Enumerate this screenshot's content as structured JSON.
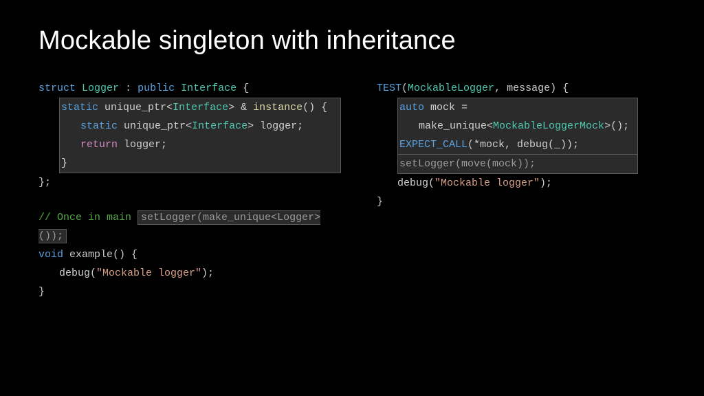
{
  "title": "Mockable singleton with inheritance",
  "left": {
    "l1_struct": "struct",
    "l1_logger": "Logger",
    "l1_colon": " : ",
    "l1_public": "public",
    "l1_interface": "Interface",
    "l1_brace": " {",
    "l2_static": "static",
    "l2_uptr": " unique_ptr<",
    "l2_iface": "Interface",
    "l2_ref": "> & ",
    "l2_inst": "instance",
    "l2_tail": "() {",
    "l3_static": "static",
    "l3_uptr": " unique_ptr<",
    "l3_iface": "Interface",
    "l3_tail": "> logger;",
    "l4_ret": "return",
    "l4_tail": " logger;",
    "l5": "}",
    "l6": "};",
    "cmt": "// Once in main ",
    "cmt_box": "setLogger(make_unique<Logger>());",
    "ex_void": "void",
    "ex_sig": " example() {",
    "ex_call_pre": "debug(",
    "ex_str": "\"Mockable logger\"",
    "ex_call_post": ");",
    "ex_close": "}"
  },
  "right": {
    "t_test": "TEST",
    "t_open": "(",
    "t_ml": "MockableLogger",
    "t_tail": ", message) {",
    "m_auto": "auto",
    "m_eq": " mock =",
    "m_mk": "make_unique<",
    "m_mlm": "MockableLoggerMock",
    "m_tail": ">();",
    "ec": "EXPECT_CALL",
    "ec_args": "(*mock, debug(_));",
    "set": "setLogger(move(mock));",
    "dbg_pre": "debug(",
    "dbg_str": "\"Mockable logger\"",
    "dbg_post": ");",
    "close": "}"
  }
}
